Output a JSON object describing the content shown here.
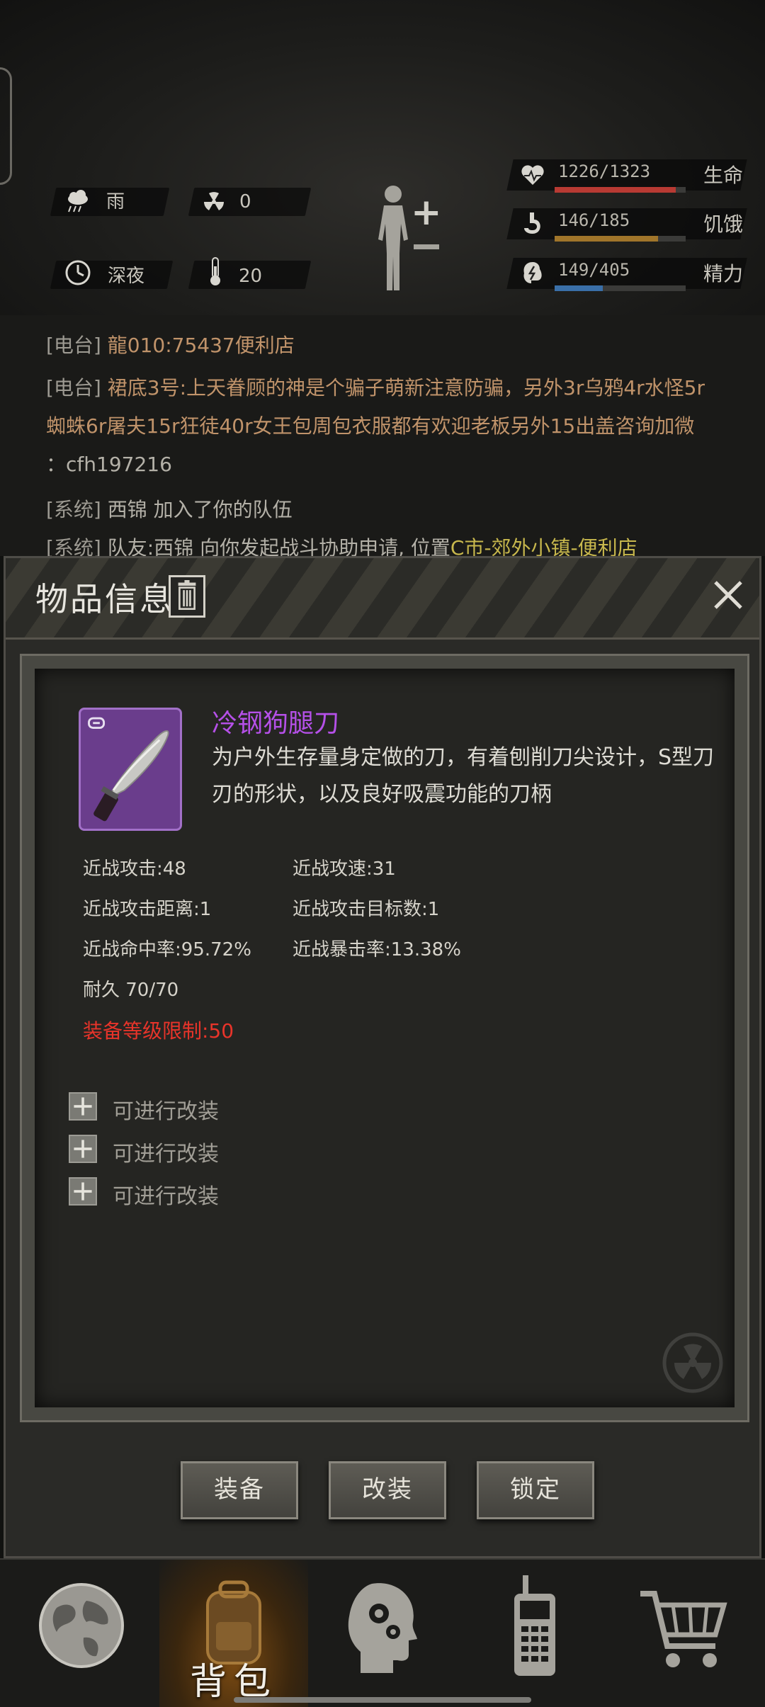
{
  "status": {
    "weather": "雨",
    "radiation": "0",
    "time_of_day": "深夜",
    "temperature": "20",
    "health": {
      "value": "1226/1323",
      "label": "生命",
      "fraction": 0.927,
      "color": "#b83a33"
    },
    "hunger": {
      "value": "146/185",
      "label": "饥饿",
      "fraction": 0.789,
      "color": "#a0752a"
    },
    "energy": {
      "value": "149/405",
      "label": "精力",
      "fraction": 0.368,
      "color": "#3a6fa8"
    }
  },
  "messages": [
    {
      "tag": "[电台]",
      "speaker": "龍010:",
      "text": "75437便利店"
    },
    {
      "tag": "[电台]",
      "speaker": "裙底3号:",
      "text": "上天眷顾的神是个骗子萌新注意防骗，另外3r乌鸦4r水怪5r"
    },
    {
      "text": "蜘蛛6r屠夫15r狂徒40r女王包周包衣服都有欢迎老板另外15出盖咨询加微"
    },
    {
      "text": "：cfh197216"
    },
    {
      "tag": "[系统]",
      "text": "西锦 加入了你的队伍"
    },
    {
      "tag": "[系统]",
      "text": "队友:西锦 向你发起战斗协助申请, 位置",
      "highlight": "C市-郊外小镇-便利店"
    }
  ],
  "dialog": {
    "title": "物品信息",
    "item": {
      "name": "冷钢狗腿刀",
      "description": "为户外生存量身定做的刀，有着刨削刀尖设计，S型刀刃的形状，以及良好吸震功能的刀柄",
      "rarity_color": "#b550e8"
    },
    "attributes": {
      "melee_attack": "近战攻击:48",
      "melee_speed": "近战攻速:31",
      "melee_range": "近战攻击距离:1",
      "melee_targets": "近战攻击目标数:1",
      "melee_hit_rate": "近战命中率:95.72%",
      "melee_crit_rate": "近战暴击率:13.38%",
      "durability": "耐久 70/70"
    },
    "level_limit": "装备等级限制:50",
    "mod_slots": [
      "可进行改装",
      "可进行改装",
      "可进行改装"
    ],
    "buttons": {
      "equip": "装备",
      "modify": "改装",
      "lock": "锁定"
    }
  },
  "nav": {
    "items": [
      "world-icon",
      "backpack-icon",
      "skills-icon",
      "radio-icon",
      "shop-icon"
    ],
    "backpack_label": "背包",
    "active": "backpack"
  }
}
